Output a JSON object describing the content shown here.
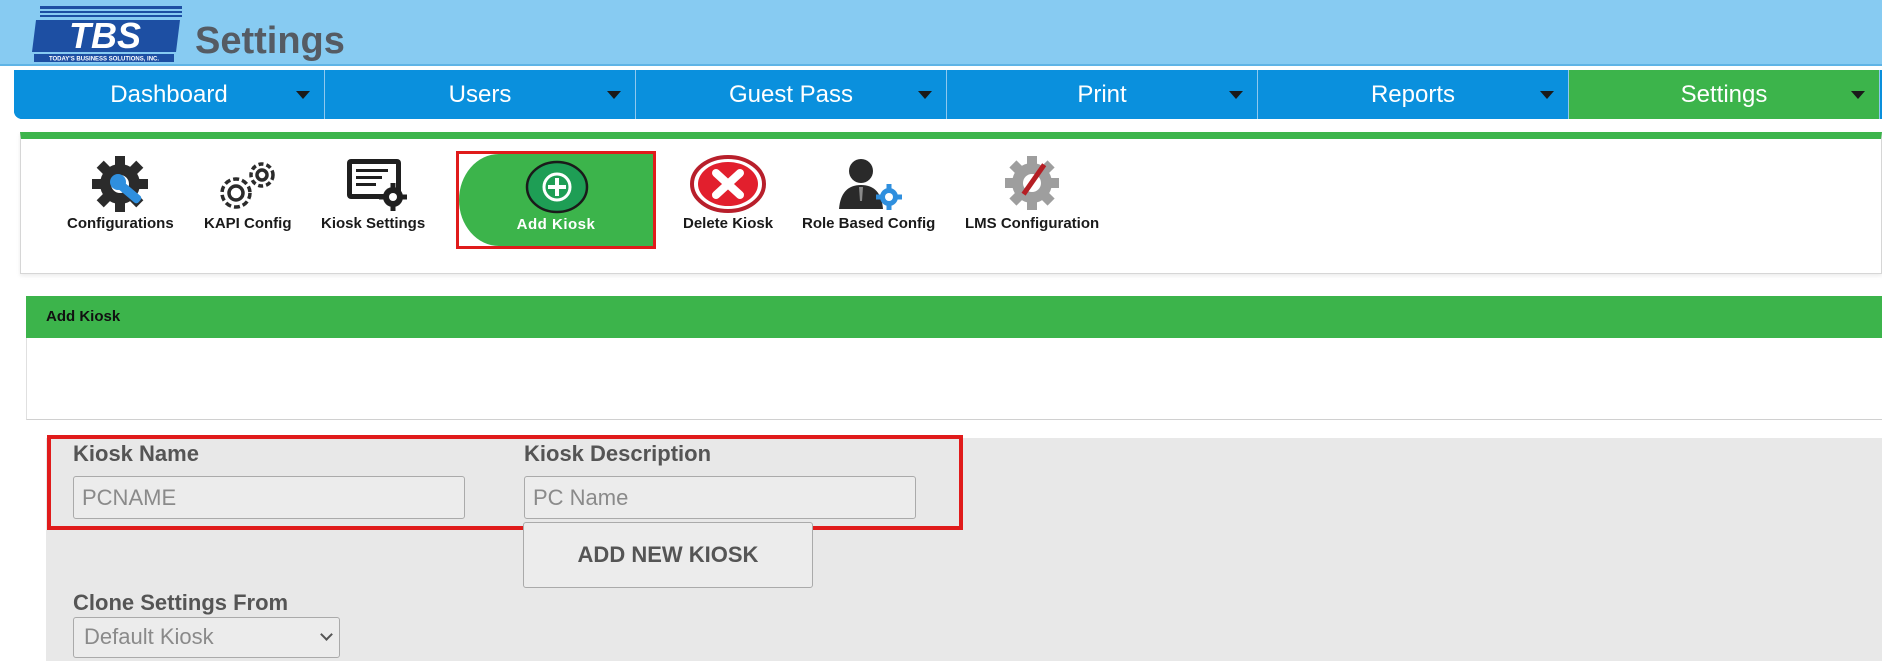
{
  "header": {
    "logo_text": "TBS",
    "logo_tagline": "TODAY'S BUSINESS SOLUTIONS, INC.",
    "title": "Settings",
    "background": "#87cbf2"
  },
  "nav": {
    "items": [
      {
        "label": "Dashboard",
        "active": false
      },
      {
        "label": "Users",
        "active": false
      },
      {
        "label": "Guest Pass",
        "active": false
      },
      {
        "label": "Print",
        "active": false
      },
      {
        "label": "Reports",
        "active": false
      },
      {
        "label": "Settings",
        "active": true
      }
    ],
    "color": "#0a90dd",
    "active_color": "#3cb44b"
  },
  "tools": {
    "configurations": {
      "label": "Configurations",
      "icon": "gear-wrench-icon"
    },
    "kapi_config": {
      "label": "KAPI Config",
      "icon": "gears-icon"
    },
    "kiosk_settings": {
      "label": "Kiosk Settings",
      "icon": "document-gear-icon"
    },
    "add_kiosk": {
      "label": "Add Kiosk",
      "icon": "plus-circle-icon"
    },
    "delete_kiosk": {
      "label": "Delete Kiosk",
      "icon": "x-circle-icon"
    },
    "role_based_config": {
      "label": "Role Based Config",
      "icon": "user-gear-icon"
    },
    "lms_configuration": {
      "label": "LMS Configuration",
      "icon": "gear-pen-icon"
    }
  },
  "section": {
    "title": "Add Kiosk"
  },
  "form": {
    "kiosk_name_label": "Kiosk Name",
    "kiosk_name_placeholder": "PCNAME",
    "kiosk_description_label": "Kiosk Description",
    "kiosk_description_placeholder": "PC Name",
    "add_button_label": "ADD NEW KIOSK",
    "clone_label": "Clone Settings From",
    "clone_selected": "Default Kiosk"
  },
  "colors": {
    "accent_green": "#3cb44b",
    "highlight_red": "#e01b1b"
  }
}
